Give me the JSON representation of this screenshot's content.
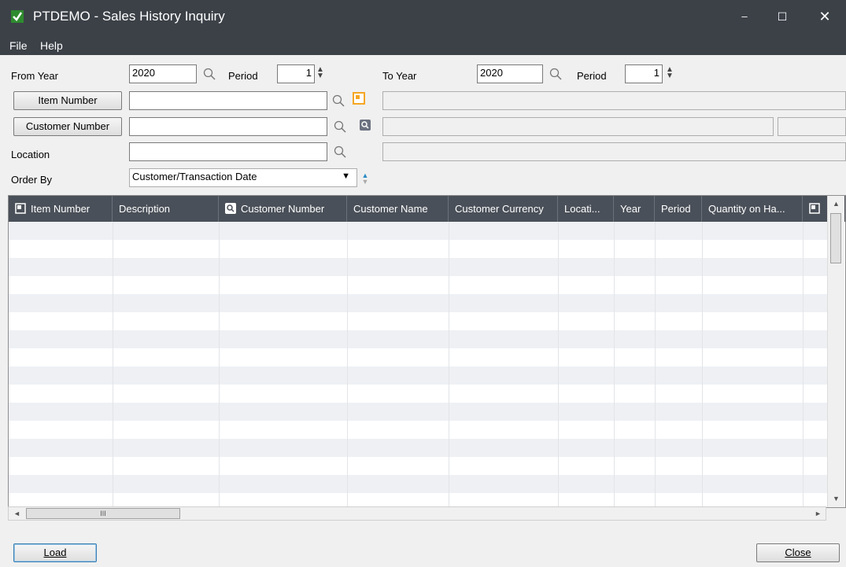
{
  "window": {
    "title": "PTDEMO - Sales History Inquiry",
    "minimize": "–",
    "maximize": "☐",
    "close": "✕"
  },
  "menu": {
    "file": "File",
    "help": "Help"
  },
  "filters": {
    "from_year_label": "From Year",
    "from_year_value": "2020",
    "from_period_label": "Period",
    "from_period_value": "1",
    "to_year_label": "To Year",
    "to_year_value": "2020",
    "to_period_label": "Period",
    "to_period_value": "1",
    "item_number_button": "Item Number",
    "item_number_value": "",
    "customer_number_button": "Customer Number",
    "customer_number_value": "",
    "location_label": "Location",
    "location_value": "",
    "order_by_label": "Order By",
    "order_by_value": "Customer/Transaction Date"
  },
  "grid": {
    "columns": [
      "Item Number",
      "Description",
      "Customer Number",
      "Customer Name",
      "Customer Currency",
      "Locati...",
      "Year",
      "Period",
      "Quantity on Ha..."
    ],
    "row_count": 16,
    "hscroll_label": "III"
  },
  "footer": {
    "load_label": "Load",
    "close_label": "Close"
  },
  "colors": {
    "title_bar": "#3c4148",
    "grid_header": "#4a5059",
    "row_alt": "#eef0f4",
    "icon_orange": "#f5a623",
    "icon_gray": "#6b7280",
    "sort_blue": "#2b8bc6"
  }
}
